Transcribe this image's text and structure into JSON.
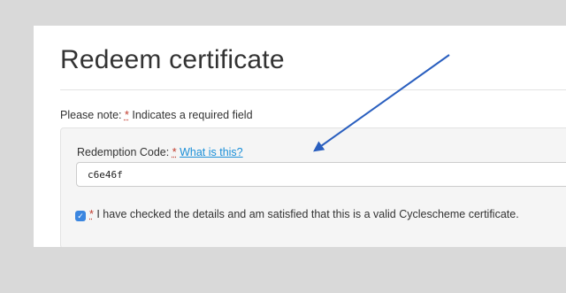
{
  "page": {
    "title": "Redeem certificate",
    "note_prefix": "Please note:",
    "required_marker": "*",
    "note_suffix": "Indicates a required field"
  },
  "form": {
    "code_label": "Redemption Code:",
    "required_marker": "*",
    "help_link": "What is this?",
    "code_value": "c6e46f",
    "checkbox_checked": true,
    "checkbox_required_marker": "*",
    "checkbox_text": "I have checked the details and am satisfied that this is a valid Cyclescheme certificate."
  },
  "colors": {
    "background": "#d9d9d9",
    "required": "#c0392b",
    "link": "#1a8fd8",
    "checkbox": "#3b86e0",
    "annotation_arrow": "#2a5fbf"
  },
  "icons": {
    "checkbox": "checkmark-icon",
    "annotation": "arrow-annotation-icon"
  }
}
